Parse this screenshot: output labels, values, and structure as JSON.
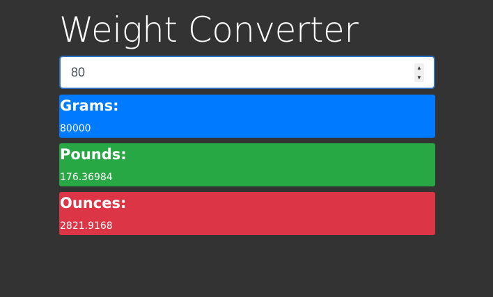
{
  "app": {
    "title": "Weight Converter"
  },
  "input": {
    "value": "80",
    "stepper_up": "▲",
    "stepper_down": "▼"
  },
  "results": [
    {
      "label": "Grams:",
      "value": "80000",
      "color": "#007bff"
    },
    {
      "label": "Pounds:",
      "value": "176.36984",
      "color": "#28a745"
    },
    {
      "label": "Ounces:",
      "value": "2821.9168",
      "color": "#dc3545"
    }
  ],
  "colors": {
    "background": "#333333",
    "input_focus_border": "#2f6fbf"
  }
}
